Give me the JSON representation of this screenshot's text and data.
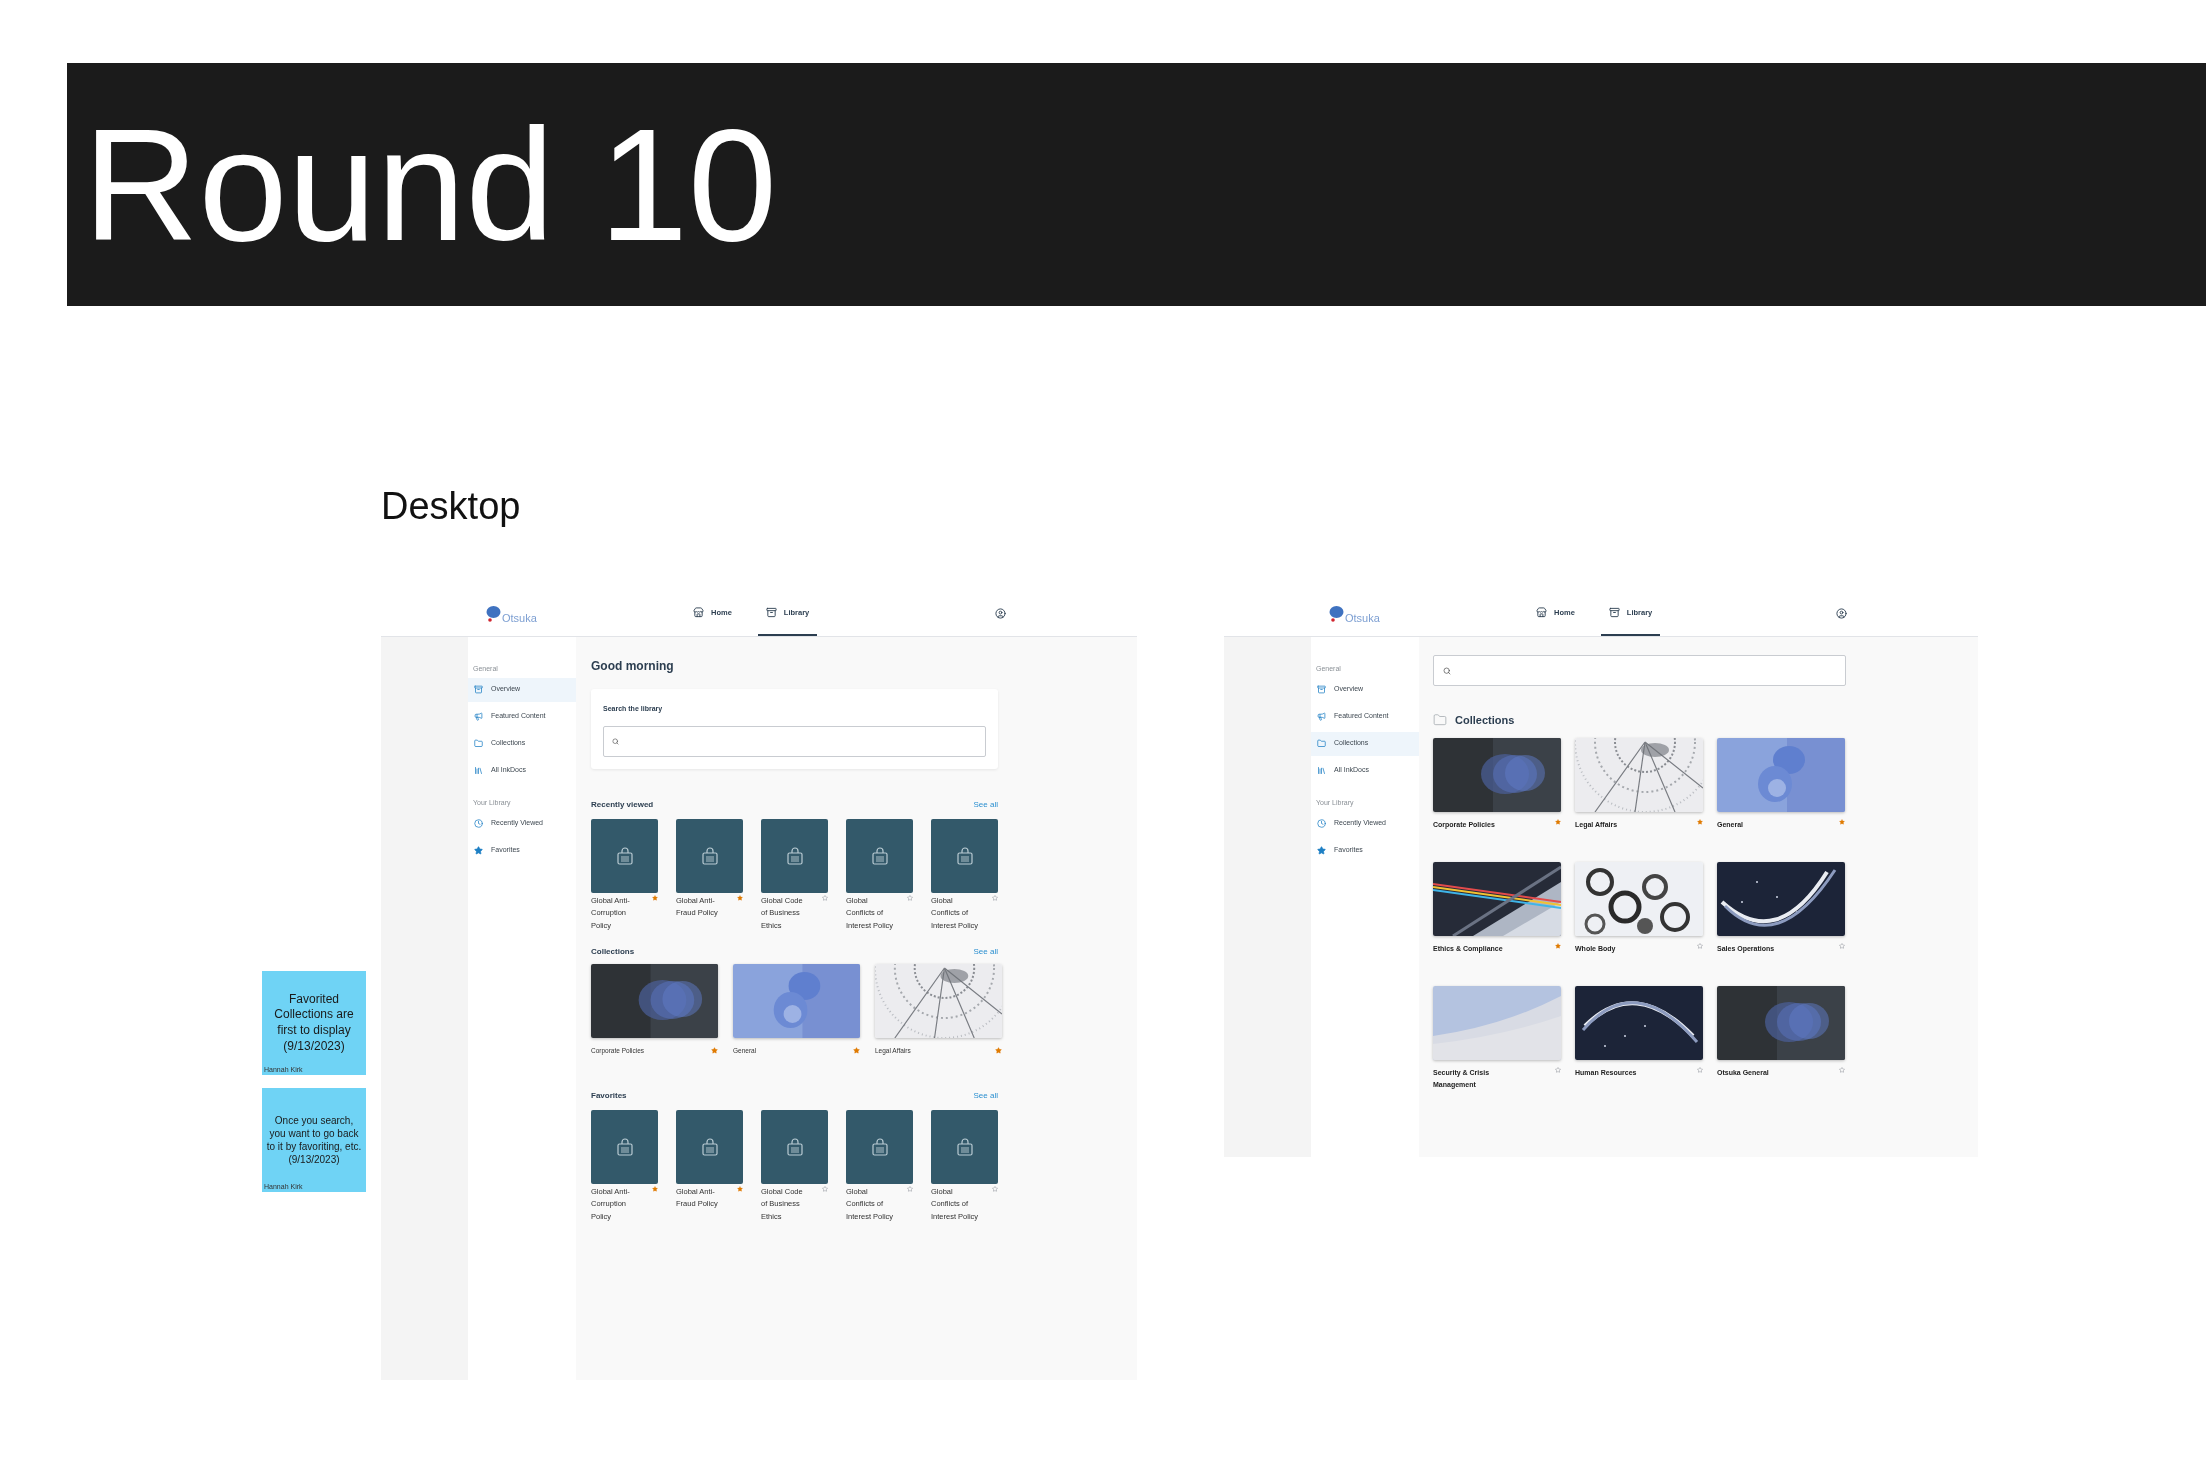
{
  "banner": {
    "title": "Round 10"
  },
  "section_title": "Desktop",
  "sticky_notes": [
    {
      "text": "Favorited Collections are first to display (9/13/2023)",
      "author": "Hannah Kirk"
    },
    {
      "text": "Once you search, you want to go back to it by favoriting, etc. (9/13/2023)",
      "author": "Hannah Kirk"
    }
  ],
  "screens": [
    {
      "kind": "overview",
      "logo": "Otsuka",
      "nav": [
        {
          "label": "Home",
          "selected": false
        },
        {
          "label": "Library",
          "selected": true
        }
      ],
      "sidebar": [
        {
          "heading": "General",
          "items": [
            {
              "label": "Overview",
              "selected": true
            },
            {
              "label": "Featured Content",
              "selected": false
            },
            {
              "label": "Collections",
              "selected": false
            },
            {
              "label": "All InkDocs",
              "selected": false
            }
          ]
        },
        {
          "heading": "Your Library",
          "items": [
            {
              "label": "Recently Viewed",
              "selected": false
            },
            {
              "label": "Favorites",
              "selected": false
            }
          ]
        }
      ],
      "greeting": "Good morning",
      "search": {
        "label": "Search the library"
      },
      "shelves": [
        {
          "kind": "documents",
          "title": "Recently viewed",
          "link": "See all",
          "items": [
            {
              "title": "Global Anti-Corruption Policy",
              "favorite": true
            },
            {
              "title": "Global Anti-Fraud Policy",
              "favorite": true
            },
            {
              "title": "Global Code of Business Ethics",
              "favorite": false
            },
            {
              "title": "Global Conflicts of Interest Policy",
              "favorite": false
            },
            {
              "title": "Global Conflicts of Interest Policy",
              "favorite": false
            }
          ]
        },
        {
          "kind": "collections",
          "title": "Collections",
          "link": "See all",
          "items": [
            {
              "title": "Corporate Policies",
              "favorite": true
            },
            {
              "title": "General",
              "favorite": true
            },
            {
              "title": "Legal Affairs",
              "favorite": true
            }
          ]
        },
        {
          "kind": "documents",
          "title": "Favorites",
          "link": "See all",
          "items": [
            {
              "title": "Global Anti-Corruption Policy",
              "favorite": true
            },
            {
              "title": "Global Anti-Fraud Policy",
              "favorite": true
            },
            {
              "title": "Global Code of Business Ethics",
              "favorite": false
            },
            {
              "title": "Global Conflicts of Interest Policy",
              "favorite": false
            },
            {
              "title": "Global Conflicts of Interest Policy",
              "favorite": false
            }
          ]
        }
      ]
    },
    {
      "kind": "collections",
      "logo": "Otsuka",
      "nav": [
        {
          "label": "Home",
          "selected": false
        },
        {
          "label": "Library",
          "selected": true
        }
      ],
      "sidebar": [
        {
          "heading": "General",
          "items": [
            {
              "label": "Overview",
              "selected": false
            },
            {
              "label": "Featured Content",
              "selected": false
            },
            {
              "label": "Collections",
              "selected": true
            },
            {
              "label": "All InkDocs",
              "selected": false
            }
          ]
        },
        {
          "heading": "Your Library",
          "items": [
            {
              "label": "Recently Viewed",
              "selected": false
            },
            {
              "label": "Favorites",
              "selected": false
            }
          ]
        }
      ],
      "heading": "Collections",
      "collections": [
        {
          "title": "Corporate Policies",
          "favorite": true
        },
        {
          "title": "Legal Affairs",
          "favorite": true
        },
        {
          "title": "General",
          "favorite": true
        },
        {
          "title": "Ethics & Compliance",
          "favorite": true
        },
        {
          "title": "Whole Body",
          "favorite": false
        },
        {
          "title": "Sales Operations",
          "favorite": false
        },
        {
          "title": "Security & Crisis Management",
          "favorite": false
        },
        {
          "title": "Human Resources",
          "favorite": false
        },
        {
          "title": "Otsuka General",
          "favorite": false
        }
      ]
    }
  ]
}
